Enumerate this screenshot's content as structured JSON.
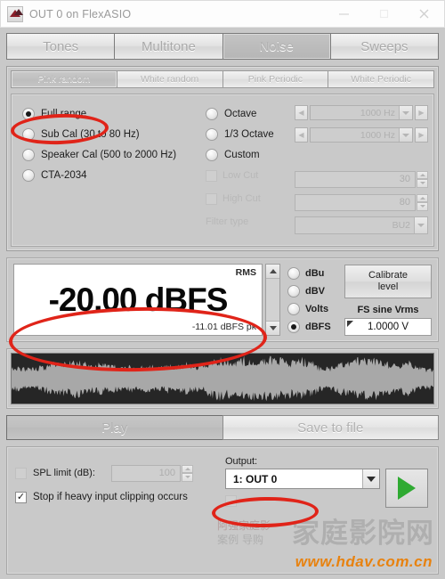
{
  "window": {
    "title": "OUT 0 on FlexASIO",
    "icon": "app-icon",
    "controls": {
      "minimize": "–",
      "maximize": "□",
      "close": "✕"
    }
  },
  "main_tabs": [
    {
      "label": "Tones",
      "active": false
    },
    {
      "label": "Multitone",
      "active": false
    },
    {
      "label": "Noise",
      "active": true
    },
    {
      "label": "Sweeps",
      "active": false
    }
  ],
  "noise_tabs": [
    {
      "label": "Pink random",
      "active": true
    },
    {
      "label": "White random",
      "active": false
    },
    {
      "label": "Pink Periodic",
      "active": false
    },
    {
      "label": "White Periodic",
      "active": false
    }
  ],
  "range_options": [
    {
      "label": "Full range",
      "selected": true,
      "enabled": true
    },
    {
      "label": "Sub Cal (30 to 80 Hz)",
      "selected": false,
      "enabled": true
    },
    {
      "label": "Speaker Cal (500 to 2000 Hz)",
      "selected": false,
      "enabled": true
    },
    {
      "label": "CTA-2034",
      "selected": false,
      "enabled": true
    }
  ],
  "band_options": [
    {
      "label": "Octave",
      "selected": false
    },
    {
      "label": "1/3 Octave",
      "selected": false
    },
    {
      "label": "Custom",
      "selected": false
    }
  ],
  "frequency_fields": [
    {
      "value": "1000 Hz",
      "enabled": false
    },
    {
      "value": "1000 Hz",
      "enabled": false
    }
  ],
  "filters": {
    "low_cut": {
      "label": "Low Cut",
      "value": "30",
      "checked": false,
      "enabled": false
    },
    "high_cut": {
      "label": "High Cut",
      "value": "80",
      "checked": false,
      "enabled": false
    },
    "filter_type": {
      "label": "Filter type",
      "value": "BU2",
      "enabled": false
    }
  },
  "level": {
    "rms_label": "RMS",
    "value": "-20.00 dBFS",
    "peak": "-11.01 dBFS pk"
  },
  "units": [
    {
      "label": "dBu",
      "selected": false
    },
    {
      "label": "dBV",
      "selected": false
    },
    {
      "label": "Volts",
      "selected": false
    },
    {
      "label": "dBFS",
      "selected": true
    }
  ],
  "calibrate": {
    "line1": "Calibrate",
    "line2": "level"
  },
  "fs_sine": {
    "label": "FS sine Vrms",
    "value": "1.0000 V"
  },
  "actions": {
    "play": "Play",
    "save": "Save to file"
  },
  "bottom": {
    "spl_limit": {
      "label": "SPL limit (dB):",
      "value": "100",
      "checked": false,
      "enabled": false
    },
    "stop_clipping": {
      "label": "Stop if heavy input clipping occurs",
      "checked": true
    },
    "output": {
      "label": "Output:",
      "value": "1: OUT 0"
    },
    "play_icon": "play-triangle-icon"
  },
  "watermark": {
    "cn_large": "家庭影院网",
    "url": "www.hdav.com.cn",
    "small1": "阿强家庭影",
    "small2": "案例  导购"
  },
  "colors": {
    "annotation": "#e02419",
    "play_green": "#2faa32",
    "watermark_orange": "#e8820f",
    "panel_bg": "#c9c9c9",
    "waveform_bg": "#262626",
    "waveform_fg": "#a8a8a8"
  },
  "annotations": [
    {
      "name": "annotation-full-range"
    },
    {
      "name": "annotation-level-value"
    },
    {
      "name": "annotation-output-select"
    }
  ]
}
